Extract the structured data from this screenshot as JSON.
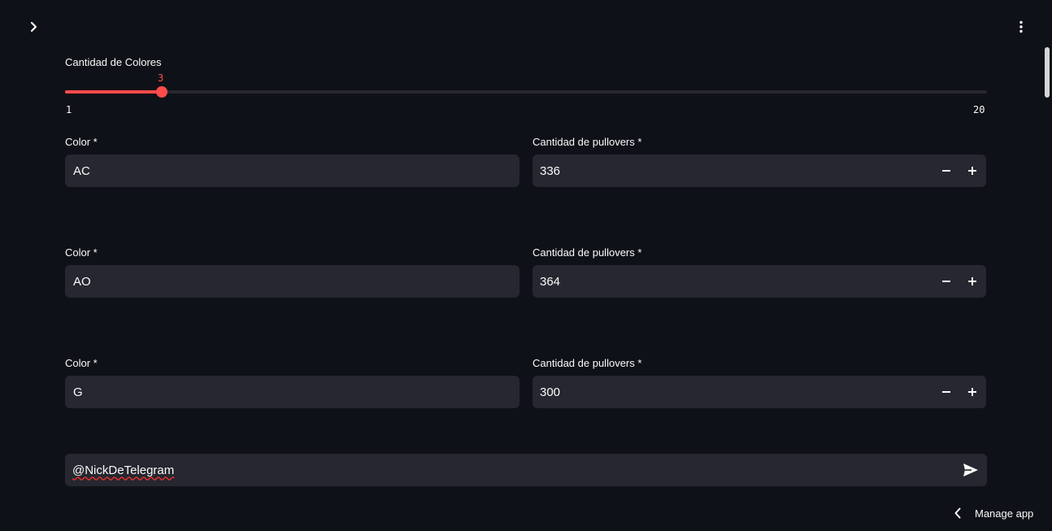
{
  "header": {
    "sidebar_toggle_icon": "chevron-right-icon",
    "menu_icon": "vertical-dots-icon"
  },
  "slider": {
    "label": "Cantidad de Colores",
    "value": "3",
    "min": "1",
    "max": "20",
    "accent_color": "#ff4b4b"
  },
  "rows": [
    {
      "color_label": "Color *",
      "color_value": "AC",
      "qty_label": "Cantidad de pullovers *",
      "qty_value": "336"
    },
    {
      "color_label": "Color *",
      "color_value": "AO",
      "qty_label": "Cantidad de pullovers *",
      "qty_value": "364"
    },
    {
      "color_label": "Color *",
      "color_value": "G",
      "qty_label": "Cantidad de pullovers *",
      "qty_value": "300"
    }
  ],
  "chat": {
    "value": "@NickDeTelegram",
    "send_icon": "send-icon"
  },
  "footer": {
    "manage_app_label": "Manage app"
  },
  "colors": {
    "background": "#0e1117",
    "input_bg": "#262730",
    "text": "#fafafa",
    "accent": "#ff4b4b"
  }
}
